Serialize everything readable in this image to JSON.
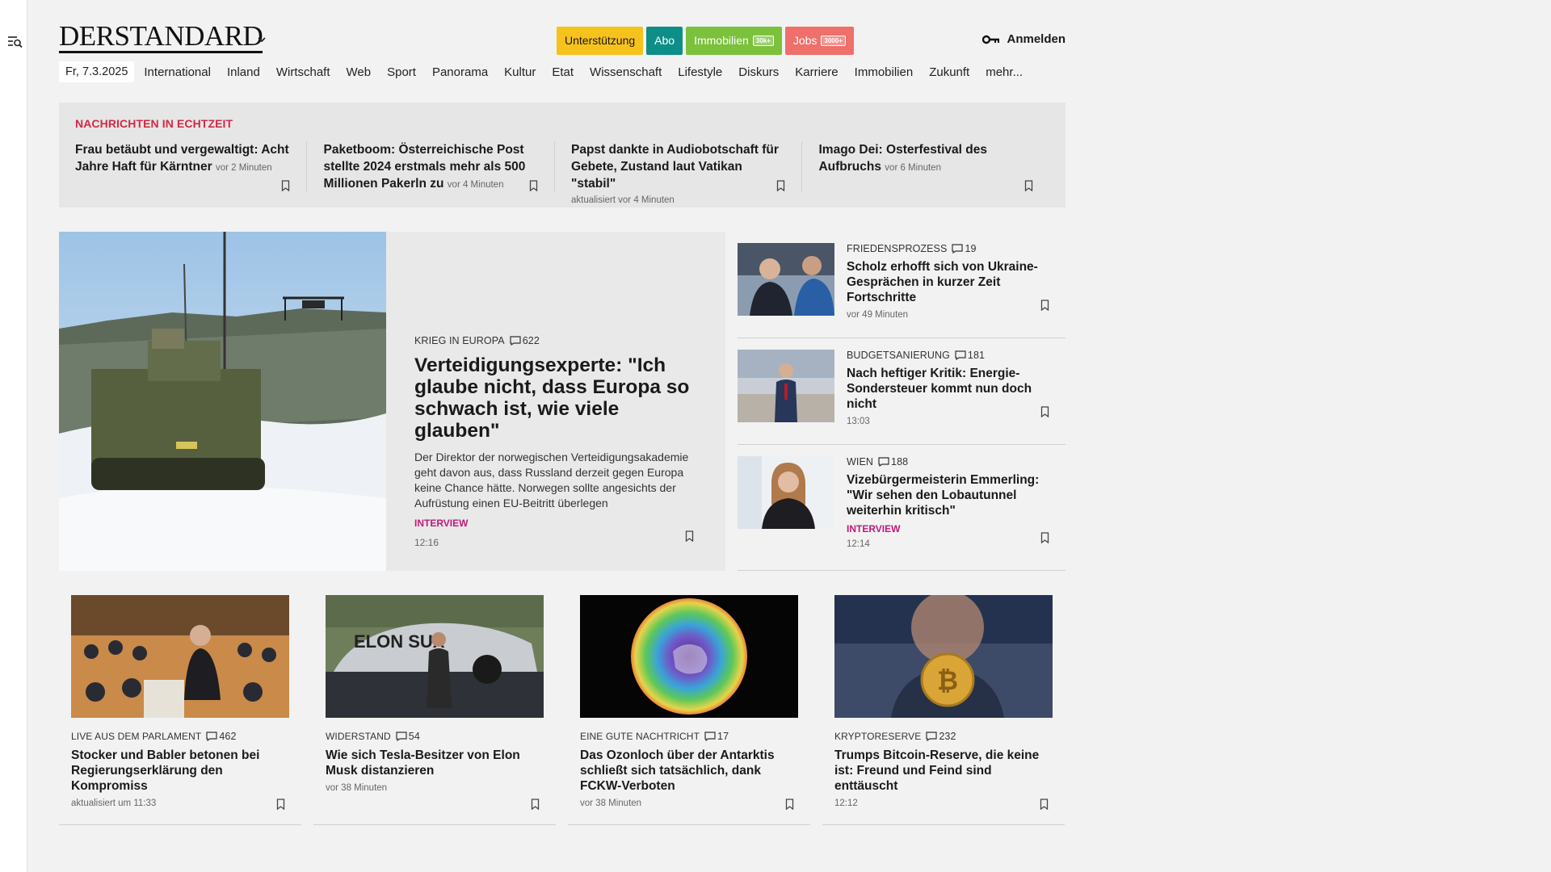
{
  "header": {
    "logo": "DERSTANDARD",
    "buttons": {
      "support": "Unterstützung",
      "abo": "Abo",
      "immo": "Immobilien",
      "immo_badge": "30k+",
      "jobs": "Jobs",
      "jobs_badge": "3000+"
    },
    "login": "Anmelden"
  },
  "nav": {
    "date": "Fr, 7.3.2025",
    "items": [
      "International",
      "Inland",
      "Wirtschaft",
      "Web",
      "Sport",
      "Panorama",
      "Kultur",
      "Etat",
      "Wissenschaft",
      "Lifestyle",
      "Diskurs",
      "Karriere",
      "Immobilien",
      "Zukunft",
      "mehr..."
    ]
  },
  "ticker": {
    "title": "NACHRICHTEN IN ECHTZEIT",
    "items": [
      {
        "title": "Frau betäubt und vergewaltigt: Acht Jahre Haft für Kärntner",
        "time": "vor 2 Minuten"
      },
      {
        "title": "Paketboom: Österreichische Post stellte 2024 erstmals mehr als 500 Millionen Pakerln zu",
        "time": "vor 4 Minuten"
      },
      {
        "title": "Papst dankte in Audiobotschaft für Gebete, Zustand laut Vatikan \"stabil\"",
        "time": "aktualisiert vor 4 Minuten"
      },
      {
        "title": "Imago Dei: Osterfestival des Aufbruchs",
        "time": "vor 6 Minuten"
      }
    ]
  },
  "lead": {
    "kicker": "KRIEG IN EUROPA",
    "comments": "622",
    "title": "Verteidigungsexperte: \"Ich glaube nicht, dass Europa so schwach ist, wie viele glauben\"",
    "teaser": "Der Direktor der norwegischen Verteidigungsakademie geht davon aus, dass Russland derzeit gegen Europa keine Chance hätte. Norwegen sollte angesichts der Aufrüstung einen EU-Beitritt überlegen",
    "tag": "INTERVIEW",
    "time": "12:16"
  },
  "side": [
    {
      "kicker": "FRIEDENSPROZESS",
      "comments": "19",
      "title": "Scholz erhofft sich von Ukraine-Gesprächen in kurzer Zeit Fortschritte",
      "tag": "",
      "time": "vor 49 Minuten"
    },
    {
      "kicker": "BUDGETSANIERUNG",
      "comments": "181",
      "title": "Nach heftiger Kritik: Energie-Sondersteuer kommt nun doch nicht",
      "tag": "",
      "time": "13:03"
    },
    {
      "kicker": "WIEN",
      "comments": "188",
      "title": "Vizebürgermeisterin Emmerling: \"Wir sehen den Lobautunnel weiterhin kritisch\"",
      "tag": "INTERVIEW",
      "time": "12:14"
    }
  ],
  "cards": [
    {
      "kicker": "LIVE AUS DEM PARLAMENT",
      "comments": "462",
      "title": "Stocker und Babler betonen bei Regierungserklärung den Kompromiss",
      "time": "aktualisiert um 11:33"
    },
    {
      "kicker": "WIDERSTAND",
      "comments": "54",
      "title": "Wie sich Tesla-Besitzer von Elon Musk distanzieren",
      "time": "vor 38 Minuten"
    },
    {
      "kicker": "EINE GUTE NACHTRICHT",
      "comments": "17",
      "title": "Das Ozonloch über der Antarktis schließt sich tatsächlich, dank FCKW-Verboten",
      "time": "vor 38 Minuten"
    },
    {
      "kicker": "KRYPTORESERVE",
      "comments": "232",
      "title": "Trumps Bitcoin-Reserve, die keine ist: Freund und Feind sind enttäuscht",
      "time": "12:12"
    }
  ],
  "images": {
    "tesla_text": "ELON SUX"
  },
  "colors": {
    "support": "#f6c21c",
    "abo": "#0e8e88",
    "immo": "#7bc13b",
    "jobs": "#ef6f6a",
    "ticker_title": "#d12a45",
    "tag": "#c2187a"
  }
}
